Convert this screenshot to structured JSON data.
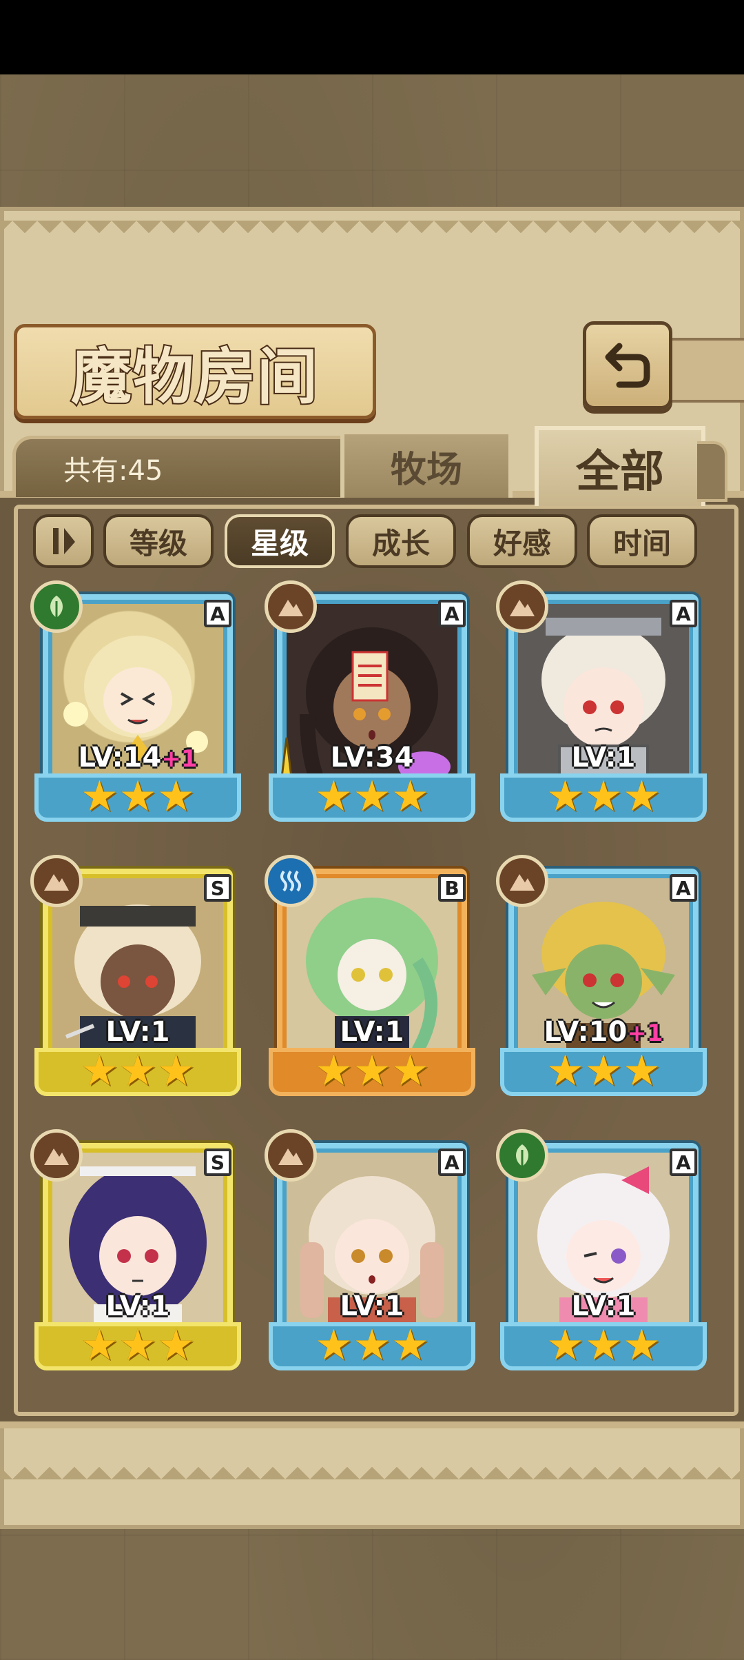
{
  "title": "魔物房间",
  "count_label": "共有:45",
  "tabs": [
    {
      "label": "牧场",
      "active": false
    },
    {
      "label": "全部",
      "active": true
    }
  ],
  "sort_options": [
    {
      "label": "等级",
      "active": false
    },
    {
      "label": "星级",
      "active": true
    },
    {
      "label": "成长",
      "active": false
    },
    {
      "label": "好感",
      "active": false
    },
    {
      "label": "时间",
      "active": false
    }
  ],
  "icons": {
    "back": "back-arrow-icon",
    "sort_toggle": "sort-order-icon"
  },
  "colors": {
    "card_blue": "#8ad3ee",
    "card_gold": "#f3e46b",
    "card_orange": "#f2b25c",
    "plus_pink": "#ff3fa4",
    "star": "#ffc21a"
  },
  "monsters": [
    {
      "level": "LV:14",
      "bonus": "+1",
      "grade": "A",
      "element": "grass",
      "stars": 3,
      "frame": "blue",
      "equipped": false
    },
    {
      "level": "LV:34",
      "bonus": "",
      "grade": "A",
      "element": "earth",
      "stars": 3,
      "frame": "blue",
      "equipped": true
    },
    {
      "level": "LV:1",
      "bonus": "",
      "grade": "A",
      "element": "earth",
      "stars": 3,
      "frame": "blue",
      "equipped": false
    },
    {
      "level": "LV:1",
      "bonus": "",
      "grade": "S",
      "element": "earth",
      "stars": 3,
      "frame": "gold",
      "equipped": false
    },
    {
      "level": "LV:1",
      "bonus": "",
      "grade": "B",
      "element": "water",
      "stars": 3,
      "frame": "orange",
      "equipped": false
    },
    {
      "level": "LV:10",
      "bonus": "+1",
      "grade": "A",
      "element": "earth",
      "stars": 3,
      "frame": "blue",
      "equipped": false
    },
    {
      "level": "LV:1",
      "bonus": "",
      "grade": "S",
      "element": "earth",
      "stars": 3,
      "frame": "gold",
      "equipped": false
    },
    {
      "level": "LV:1",
      "bonus": "",
      "grade": "A",
      "element": "earth",
      "stars": 3,
      "frame": "blue",
      "equipped": false
    },
    {
      "level": "LV:1",
      "bonus": "",
      "grade": "A",
      "element": "grass",
      "stars": 3,
      "frame": "blue",
      "equipped": false
    }
  ]
}
